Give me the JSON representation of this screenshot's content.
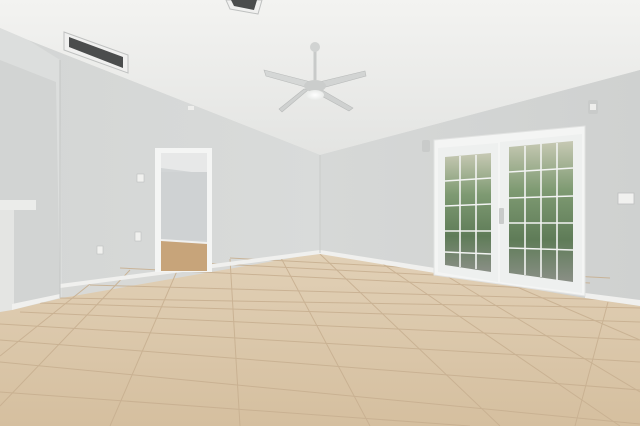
{
  "scene": {
    "colors": {
      "ceiling": "#eeeeec",
      "wall_back": "#d6d8d7",
      "wall_left": "#dadcdb",
      "wall_right": "#d3d5d4",
      "floor": "#dcc8ab",
      "grout": "#c9b394",
      "baseboard": "#f2f2f0",
      "door_frame": "#f4f5f4",
      "glass_outdoor": "#7f9a75"
    },
    "icons": [
      "ceiling-fan-icon",
      "air-vent-icon",
      "wall-sconce-icon",
      "light-switch-icon",
      "outlet-icon"
    ]
  }
}
